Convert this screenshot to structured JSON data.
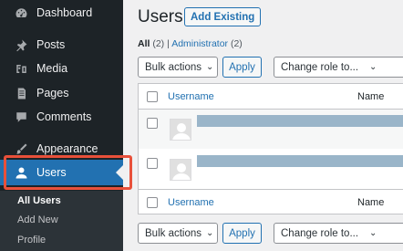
{
  "sidebar": {
    "items": [
      {
        "label": "Dashboard",
        "icon": "dashboard-icon"
      },
      {
        "label": "Posts",
        "icon": "pin-icon"
      },
      {
        "label": "Media",
        "icon": "media-icon"
      },
      {
        "label": "Pages",
        "icon": "page-icon"
      },
      {
        "label": "Comments",
        "icon": "comment-icon"
      },
      {
        "label": "Appearance",
        "icon": "brush-icon"
      },
      {
        "label": "Users",
        "icon": "user-icon",
        "active": true
      }
    ],
    "submenu": [
      "All Users",
      "Add New",
      "Profile"
    ]
  },
  "header": {
    "title": "Users",
    "add_existing": "Add Existing"
  },
  "filters": {
    "all_label": "All",
    "all_count": "(2)",
    "separator": "|",
    "admin_label": "Administrator",
    "admin_count": "(2)"
  },
  "actions_top": {
    "bulk": "Bulk actions",
    "apply": "Apply",
    "change_role": "Change role to..."
  },
  "actions_bottom": {
    "bulk": "Bulk actions",
    "apply": "Apply",
    "change_role": "Change role to..."
  },
  "table": {
    "columns": {
      "username": "Username",
      "name": "Name"
    }
  },
  "colors": {
    "sidebar_bg": "#1d2327",
    "accent": "#2271b1",
    "highlight": "#e8503a"
  }
}
